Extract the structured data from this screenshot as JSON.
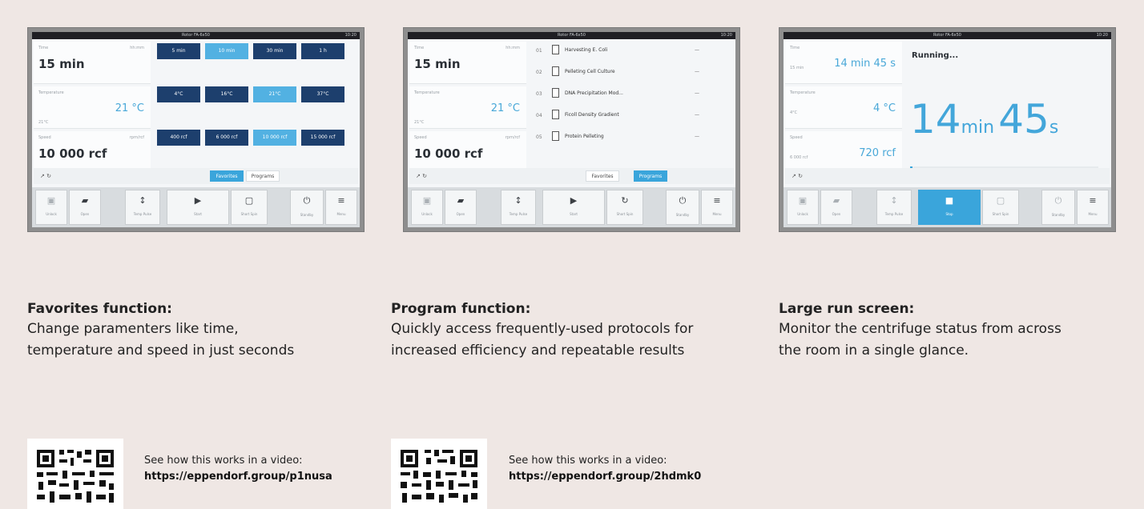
{
  "panels": [
    {
      "title": "Rotor FA-6x50",
      "time_display": "10:20",
      "params": {
        "time_label": "Time",
        "time_value": "15 min",
        "time_unit": "hh:mm",
        "temp_label": "Temperature",
        "temp_value": "21 °C",
        "temp_set": "21°C",
        "speed_label": "Speed",
        "speed_value": "10 000 rcf",
        "speed_unit": "rpm/rcf",
        "rotor_label": "Rotor"
      },
      "favorites": [
        "5 min",
        "10 min",
        "30 min",
        "1 h",
        "4°C",
        "16°C",
        "21°C",
        "37°C",
        "400 rcf",
        "6 000 rcf",
        "10 000 rcf",
        "15 000 rcf"
      ],
      "favorites_selected": [
        1,
        6,
        10
      ],
      "tabs": [
        "Favorites",
        "Programs"
      ],
      "active_tab": 0,
      "nav": [
        "Unlock",
        "Open",
        "Temp Pulse",
        "Start",
        "Short Spin",
        "Standby",
        "Menu"
      ]
    },
    {
      "title": "Rotor FA-6x50",
      "time_display": "10:20",
      "params": {
        "time_label": "Time",
        "time_value": "15 min",
        "time_unit": "hh:mm",
        "temp_label": "Temperature",
        "temp_value": "21 °C",
        "temp_set": "21°C",
        "speed_label": "Speed",
        "speed_value": "10 000 rcf",
        "speed_unit": "rpm/rcf",
        "rotor_label": "Rotor"
      },
      "programs": [
        {
          "num": "01",
          "name": "Harvesting E. Coli"
        },
        {
          "num": "02",
          "name": "Pelleting Cell Culture"
        },
        {
          "num": "03",
          "name": "DNA Precipitation Mod..."
        },
        {
          "num": "04",
          "name": "Ficoll Density Gradient"
        },
        {
          "num": "05",
          "name": "Protein Pelleting"
        }
      ],
      "tabs": [
        "Favorites",
        "Programs"
      ],
      "active_tab": 1,
      "nav": [
        "Unlock",
        "Open",
        "Temp Pulse",
        "Start",
        "Short Spin",
        "Standby",
        "Menu"
      ]
    },
    {
      "title": "Rotor FA-6x50",
      "time_display": "10:20",
      "params": {
        "time_label": "Time",
        "time_value": "14 min 45 s",
        "time_sub": "15 min",
        "temp_label": "Temperature",
        "temp_value": "4 °C",
        "temp_sub": "4°C",
        "speed_label": "Speed",
        "speed_value": "720 rcf",
        "speed_sub": "6 000 rcf",
        "rotor_label": "Rotor"
      },
      "run_status": "Running...",
      "big_min": "14",
      "big_min_unit": "min",
      "big_sec": "45",
      "big_sec_unit": "s",
      "progress_text": "1%",
      "nav": [
        "Unlock",
        "Open",
        "Temp Pulse",
        "Stop",
        "Short Spin",
        "Standby",
        "Menu"
      ]
    }
  ],
  "captions": [
    {
      "heading": "Favorites function:",
      "body_l1": "Change paramenters like time,",
      "body_l2": "temperature and speed in just seconds"
    },
    {
      "heading": "Program function:",
      "body_l1": "Quickly access frequently-used protocols for",
      "body_l2": "increased efficiency and repeatable results"
    },
    {
      "heading": "Large run screen:",
      "body_l1": "Monitor the centrifuge status from across",
      "body_l2": "the room in a single glance."
    }
  ],
  "videos": [
    {
      "lead": "See how this works in a video:",
      "url": "https://eppendorf.group/p1nusa"
    },
    {
      "lead": "See how this works in a video:",
      "url": "https://eppendorf.group/2hdmk0"
    }
  ],
  "colors": {
    "accent": "#3aa5db",
    "dark_button": "#1d3f6d",
    "background": "#efe7e4"
  }
}
